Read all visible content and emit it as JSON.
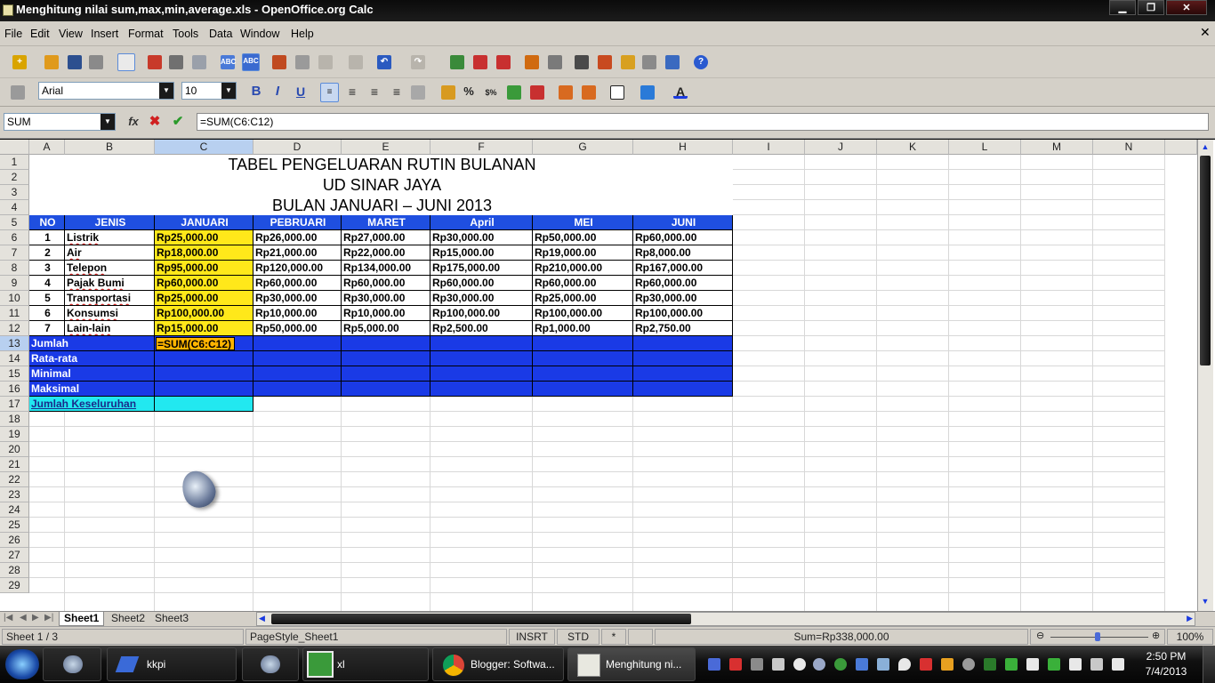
{
  "window": {
    "title": "Menghitung  nilai sum,max,min,average.xls - OpenOffice.org Calc"
  },
  "menu": [
    "File",
    "Edit",
    "View",
    "Insert",
    "Format",
    "Tools",
    "Data",
    "Window",
    "Help"
  ],
  "toolbar": {
    "font_name": "Arial",
    "font_size": "10"
  },
  "formula_bar": {
    "name_box": "SUM",
    "formula": "=SUM(C6:C12)"
  },
  "columns": [
    "A",
    "B",
    "C",
    "D",
    "E",
    "F",
    "G",
    "H",
    "I",
    "J",
    "K",
    "L",
    "M",
    "N"
  ],
  "rows": [
    "1",
    "2",
    "3",
    "4",
    "5",
    "6",
    "7",
    "8",
    "9",
    "10",
    "11",
    "12",
    "13",
    "14",
    "15",
    "16",
    "17",
    "18",
    "19",
    "20",
    "21",
    "22",
    "23",
    "24",
    "25",
    "26",
    "27",
    "28",
    "29"
  ],
  "sheet": {
    "title1": "TABEL PENGELUARAN RUTIN BULANAN",
    "title2": "UD SINAR JAYA",
    "title3": "BULAN JANUARI – JUNI 2013",
    "headers": [
      "NO",
      "JENIS",
      "JANUARI",
      "PEBRUARI",
      "MARET",
      "April",
      "MEI",
      "JUNI"
    ],
    "data": [
      [
        "1",
        "Listrik",
        "Rp25,000.00",
        "Rp26,000.00",
        "Rp27,000.00",
        "Rp30,000.00",
        "Rp50,000.00",
        "Rp60,000.00"
      ],
      [
        "2",
        "Air",
        "Rp18,000.00",
        "Rp21,000.00",
        "Rp22,000.00",
        "Rp15,000.00",
        "Rp19,000.00",
        "Rp8,000.00"
      ],
      [
        "3",
        "Telepon",
        "Rp95,000.00",
        "Rp120,000.00",
        "Rp134,000.00",
        "Rp175,000.00",
        "Rp210,000.00",
        "Rp167,000.00"
      ],
      [
        "4",
        "Pajak Bumi",
        "Rp60,000.00",
        "Rp60,000.00",
        "Rp60,000.00",
        "Rp60,000.00",
        "Rp60,000.00",
        "Rp60,000.00"
      ],
      [
        "5",
        "Transportasi",
        "Rp25,000.00",
        "Rp30,000.00",
        "Rp30,000.00",
        "Rp30,000.00",
        "Rp25,000.00",
        "Rp30,000.00"
      ],
      [
        "6",
        "Konsumsi",
        "Rp100,000.00",
        "Rp10,000.00",
        "Rp10,000.00",
        "Rp100,000.00",
        "Rp100,000.00",
        "Rp100,000.00"
      ],
      [
        "7",
        "Lain-lain",
        "Rp15,000.00",
        "Rp50,000.00",
        "Rp5,000.00",
        "Rp2,500.00",
        "Rp1,000.00",
        "Rp2,750.00"
      ]
    ],
    "summary_labels": [
      "Jumlah",
      "Rata-rata",
      "Minimal",
      "Maksimal"
    ],
    "total_label": "Jumlah Keseluruhan",
    "editing_cell_text": "=SUM(C6:C12)"
  },
  "tabs": [
    "Sheet1",
    "Sheet2",
    "Sheet3"
  ],
  "status": {
    "sheet": "Sheet 1 / 3",
    "page_style": "PageStyle_Sheet1",
    "insert_mode": "INSRT",
    "selection_mode": "STD",
    "modified": "*",
    "sum": "Sum=Rp338,000.00",
    "zoom": "100%"
  },
  "taskbar": {
    "items": [
      "kkpi",
      "xl",
      "Blogger: Softwa...",
      "Menghitung  ni..."
    ],
    "time": "2:50 PM",
    "date": "7/4/2013"
  },
  "colors": {
    "header_blue": "#1f4fe0",
    "summary_blue": "#1a3ae6",
    "highlight_yellow": "#ffe81a",
    "cyan": "#22e8f0",
    "editing_orange": "#ffb400"
  }
}
